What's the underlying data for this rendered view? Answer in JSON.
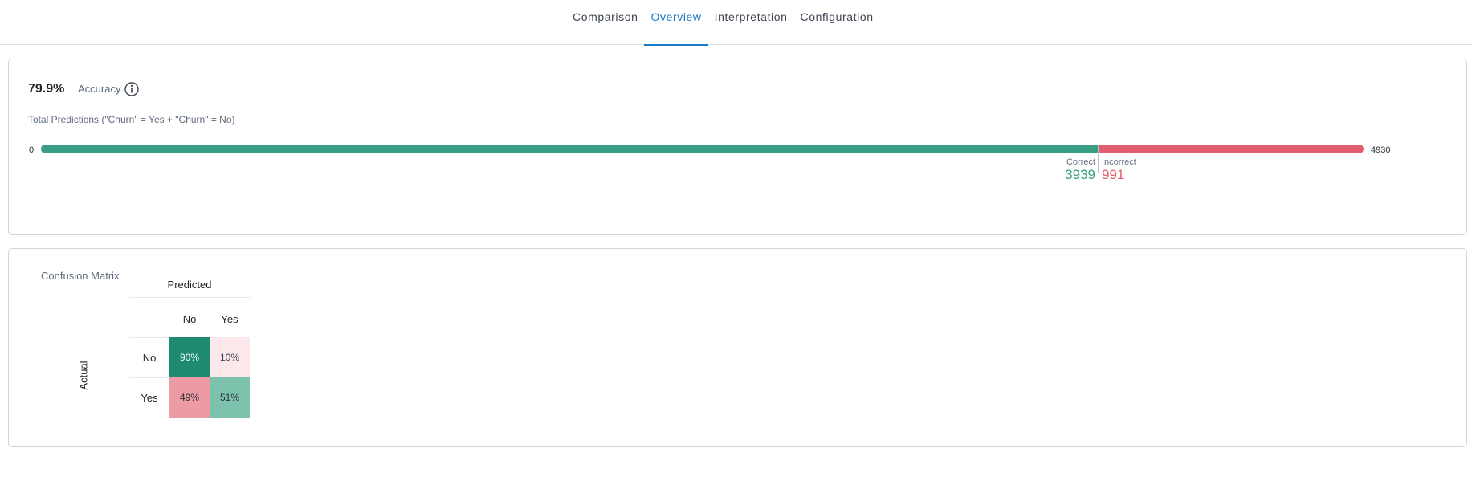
{
  "tabs": [
    {
      "label": "Comparison",
      "active": false
    },
    {
      "label": "Overview",
      "active": true
    },
    {
      "label": "Interpretation",
      "active": false
    },
    {
      "label": "Configuration",
      "active": false
    }
  ],
  "accuracy": {
    "value": "79.9%",
    "label": "Accuracy",
    "total_label": "Total Predictions (\"Churn\" = Yes + \"Churn\" = No)",
    "axis_min": "0",
    "axis_max": "4930",
    "total": 4930,
    "correct": {
      "label": "Correct",
      "value": 3939,
      "color": "#3a9e84"
    },
    "incorrect": {
      "label": "Incorrect",
      "value": 991,
      "color": "#e25e6e"
    }
  },
  "confusion_matrix": {
    "title": "Confusion Matrix",
    "predicted_label": "Predicted",
    "actual_label": "Actual",
    "columns": [
      "No",
      "Yes"
    ],
    "rows": [
      {
        "label": "No",
        "cells": [
          {
            "text": "90%",
            "bg": "#1e8a70",
            "fg": "#ffffff"
          },
          {
            "text": "10%",
            "bg": "#fce8ea",
            "fg": "#3d4451"
          }
        ]
      },
      {
        "label": "Yes",
        "cells": [
          {
            "text": "49%",
            "bg": "#ec9aa4",
            "fg": "#2b2f36"
          },
          {
            "text": "51%",
            "bg": "#7cc2ad",
            "fg": "#2b2f36"
          }
        ]
      }
    ]
  }
}
